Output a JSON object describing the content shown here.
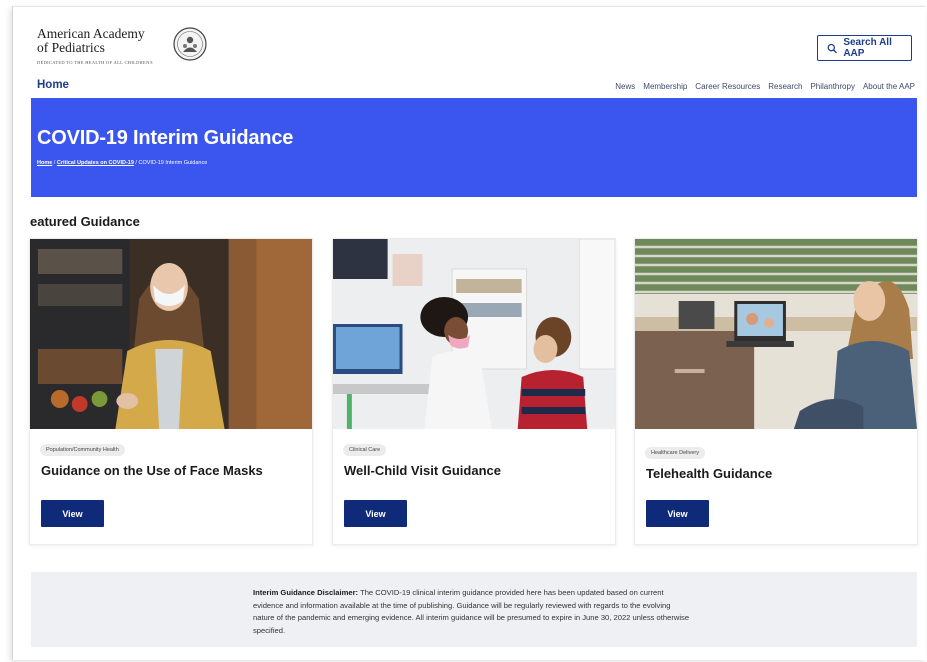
{
  "org": {
    "name_line1": "American Academy",
    "name_line2": "of Pediatrics",
    "tagline": "DEDICATED TO THE HEALTH OF ALL CHILDREN®"
  },
  "search": {
    "label": "Search All AAP"
  },
  "nav": {
    "home": "Home",
    "links": [
      "News",
      "Membership",
      "Career Resources",
      "Research",
      "Philanthropy",
      "About the AAP"
    ]
  },
  "hero": {
    "title": "COVID-19 Interim Guidance",
    "breadcrumb": [
      "Home",
      "Critical Updates on COVID-19",
      "COVID-19 Interim Guidance"
    ],
    "separator": " / "
  },
  "section": {
    "title": "eatured Guidance"
  },
  "cards": [
    {
      "tag": "Population/Community Health",
      "title": "Guidance on the Use of Face Masks",
      "button": "View"
    },
    {
      "tag": "Clinical Care",
      "title": "Well-Child Visit Guidance",
      "button": "View"
    },
    {
      "tag": "Healthcare Delivery",
      "title": "Telehealth Guidance",
      "button": "View"
    }
  ],
  "disclaimer": {
    "label": "Interim Guidance Disclaimer:",
    "text": " The COVID-19 clinical interim guidance provided here has been updated based on current evidence and information available at the time of publishing. Guidance will be regularly reviewed with regards to the evolving nature of the pandemic and emerging evidence. All interim guidance will be presumed to expire in June 30, 2022 unless otherwise specified."
  },
  "colors": {
    "hero_blue": "#3a56ee",
    "button_navy": "#102a7a",
    "link_blue": "#1d3c8a",
    "disclaimer_bg": "#eef0f3"
  },
  "icons": {
    "search": "search-icon",
    "seal": "aap-seal-logo"
  }
}
